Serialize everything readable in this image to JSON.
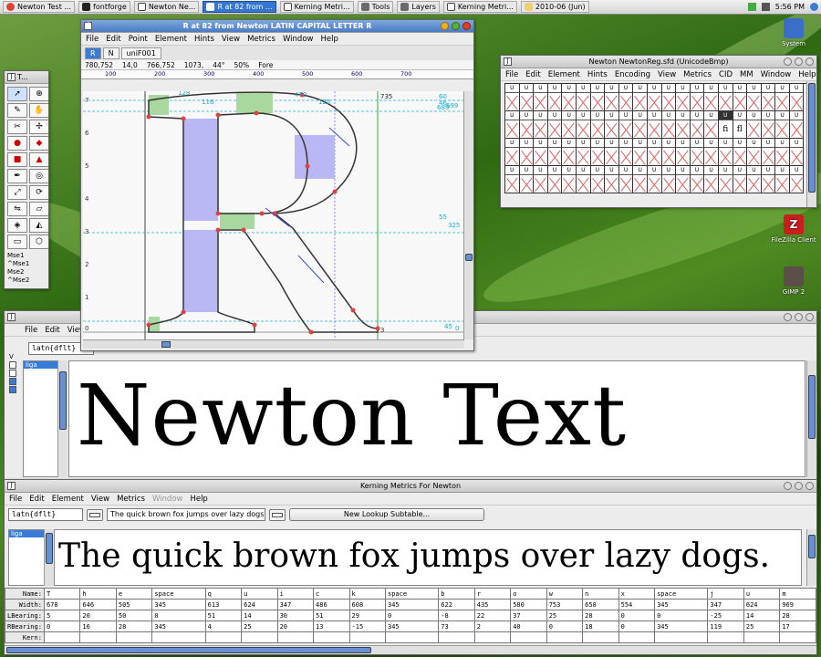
{
  "taskbar": {
    "tasks": [
      {
        "label": "Newton Test ...",
        "icon": "chrome-icon"
      },
      {
        "label": "fontforge",
        "icon": "terminal-icon"
      },
      {
        "label": "Newton  Ne...",
        "icon": "fontforge-icon"
      },
      {
        "label": "R at 82 from ...",
        "icon": "fontforge-icon",
        "active": true
      },
      {
        "label": "Kerning Metri...",
        "icon": "fontforge-icon"
      },
      {
        "label": "Tools",
        "icon": "tools-icon"
      },
      {
        "label": "Layers",
        "icon": "layers-icon"
      },
      {
        "label": "Kerning Metri...",
        "icon": "fontforge-icon"
      },
      {
        "label": "2010-06 (Jun)",
        "icon": "calendar-icon"
      }
    ],
    "clock": "5:56 PM"
  },
  "desktop": {
    "icons": [
      {
        "label": "System",
        "color": "#3b6ec8"
      },
      {
        "label": "FileZilla Client",
        "color": "#c81e1e"
      },
      {
        "label": "GIMP 2",
        "color": "#5a5048"
      }
    ]
  },
  "glyph_window": {
    "title": "R at 82 from Newton LATIN CAPITAL LETTER R",
    "menu": [
      "File",
      "Edit",
      "Point",
      "Element",
      "Hints",
      "View",
      "Metrics",
      "Window",
      "Help"
    ],
    "tabs": [
      "R",
      "N",
      "uniF001"
    ],
    "info": [
      "780,752",
      "14,0",
      "766,752",
      "1073,",
      "44°",
      "50%",
      "Fore"
    ],
    "ruler_labels": [
      "100",
      "200",
      "300",
      "400",
      "500",
      "600",
      "700"
    ],
    "annotations": [
      "735",
      "479",
      "125",
      "116",
      "128",
      "699",
      "689",
      "60",
      "46",
      "55",
      "325",
      "45",
      "0",
      "7",
      "6",
      "5",
      "4",
      "3",
      "2",
      "1",
      "0",
      "3"
    ]
  },
  "tools_window": {
    "title": "T...",
    "mouse_labels": [
      "Mse1",
      "^Mse1",
      "Mse2",
      "^Mse2"
    ]
  },
  "fontview_window": {
    "title": "Newton  NewtonReg.sfd (UnicodeBmp)",
    "menu": [
      "File",
      "Edit",
      "Element",
      "Hints",
      "Encoding",
      "View",
      "Metrics",
      "CID",
      "MM",
      "Window",
      "Help"
    ],
    "cell_label": "U",
    "special_cells": {
      "fi": "ﬁ",
      "fl": "ﬂ"
    }
  },
  "metrics_window": {
    "menu": [
      "File",
      "Edit",
      "View"
    ],
    "script_field": "latn{dflt}",
    "lookup": "liga",
    "preview_text": "Newton Text",
    "checkbox_label": "V"
  },
  "kerning_window": {
    "title": "Kerning Metrics For Newton",
    "menu": [
      "File",
      "Edit",
      "Element",
      "View",
      "Metrics",
      "Window",
      "Help"
    ],
    "disabled_menu": [
      "Window"
    ],
    "script_field": "latn{dflt}",
    "text_field": "The quick brown fox jumps over lazy dogs.",
    "subtable": "New Lookup Subtable...",
    "lookup": "liga",
    "preview_text": "The quick brown fox jumps over lazy dogs.",
    "row_headers": [
      "Name:",
      "Width:",
      "LBearing:",
      "RBearing:",
      "Kern:"
    ],
    "names": [
      "T",
      "h",
      "e",
      "space",
      "q",
      "u",
      "i",
      "c",
      "k",
      "space",
      "b",
      "r",
      "o",
      "w",
      "n",
      "x",
      "space",
      "j",
      "u",
      "m"
    ],
    "widths": [
      "678",
      "646",
      "505",
      "345",
      "613",
      "624",
      "347",
      "486",
      "608",
      "345",
      "622",
      "435",
      "580",
      "753",
      "658",
      "554",
      "345",
      "347",
      "624",
      "969"
    ],
    "lbearings": [
      "5",
      "20",
      "50",
      "0",
      "51",
      "14",
      "30",
      "51",
      "29",
      "0",
      "-8",
      "22",
      "37",
      "25",
      "28",
      "0",
      "0",
      "-25",
      "14",
      "28"
    ],
    "rbearings": [
      "0",
      "16",
      "28",
      "345",
      "4",
      "25",
      "20",
      "13",
      "-15",
      "345",
      "73",
      "2",
      "40",
      "0",
      "18",
      "0",
      "345",
      "119",
      "25",
      "17"
    ]
  }
}
